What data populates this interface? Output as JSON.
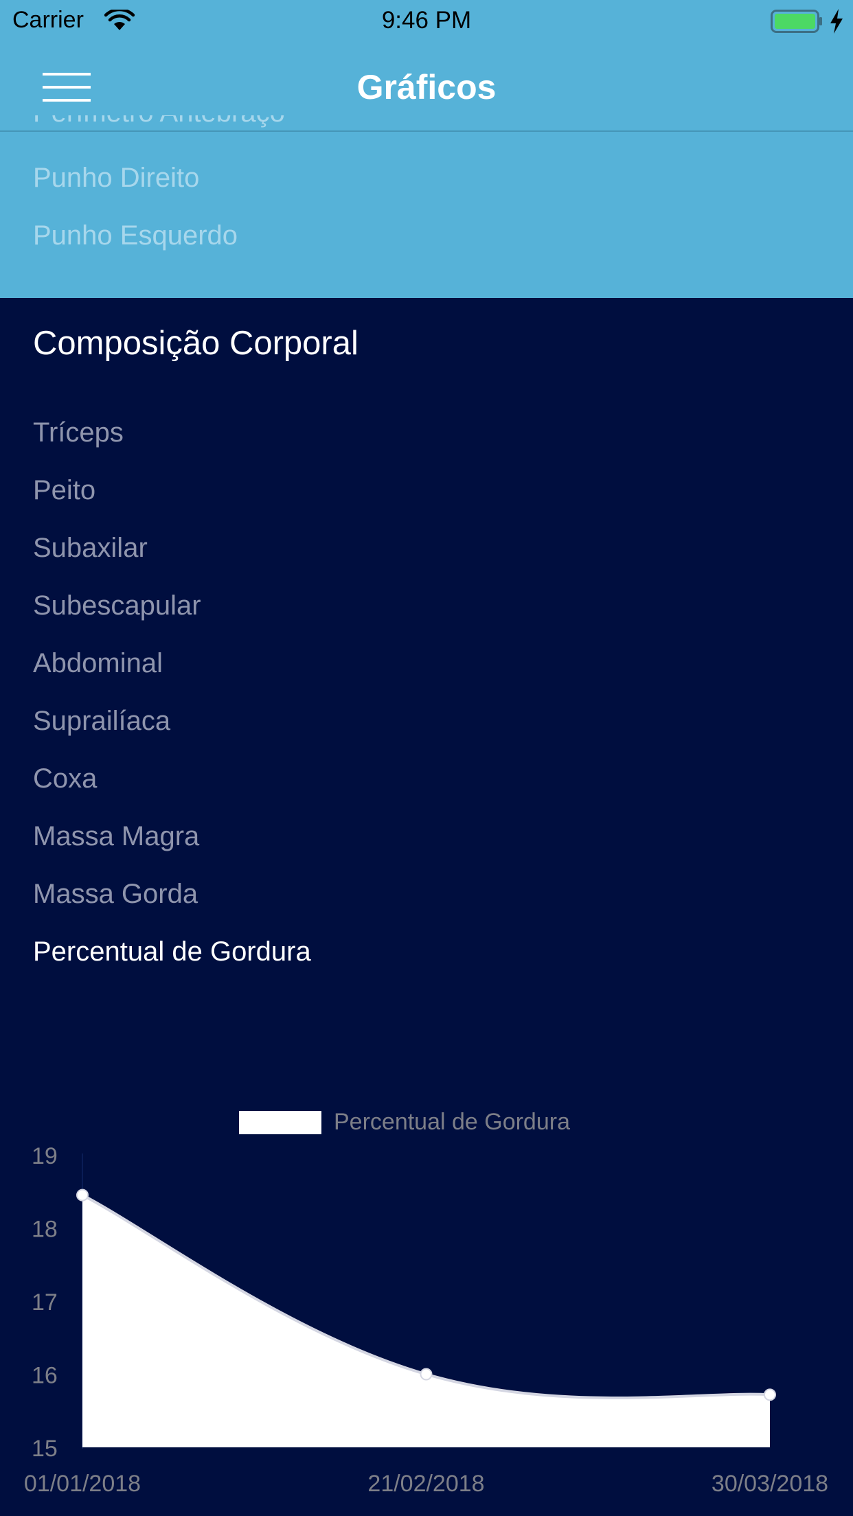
{
  "status": {
    "carrier": "Carrier",
    "time": "9:46 PM",
    "battery_color": "#4cd964"
  },
  "nav": {
    "title": "Gráficos"
  },
  "top_list": {
    "clipped_item": "Perímetro Antebraço",
    "items": [
      "Punho Direito",
      "Punho Esquerdo"
    ]
  },
  "section": {
    "title": "Composição Corporal",
    "items": [
      "Tríceps",
      "Peito",
      "Subaxilar",
      "Subescapular",
      "Abdominal",
      "Suprailíaca",
      "Coxa",
      "Massa Magra",
      "Massa Gorda",
      "Percentual de Gordura"
    ],
    "selected_index": 9
  },
  "colors": {
    "top_background": "#56b2d8",
    "page_background": "#000e3f",
    "chart_fill": "#ffffff",
    "axis_text": "#7d7f88"
  },
  "chart_data": {
    "type": "area",
    "x": [
      "01/01/2018",
      "21/02/2018",
      "30/03/2018"
    ],
    "series": [
      {
        "name": "Percentual de Gordura",
        "values": [
          18.45,
          16.0,
          15.72
        ]
      }
    ],
    "yticks": [
      "15",
      "16",
      "17",
      "18",
      "19"
    ],
    "ylim": [
      15,
      19
    ],
    "legend": "top-center",
    "grid": false
  }
}
